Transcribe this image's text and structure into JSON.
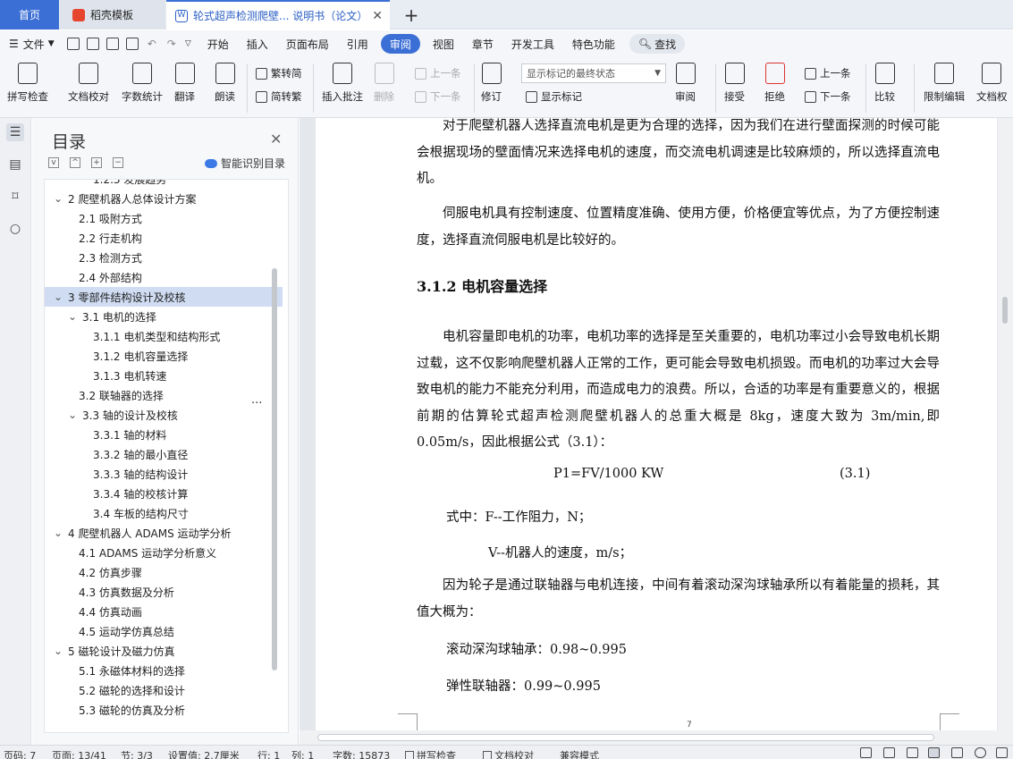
{
  "tabs": {
    "home": "首页",
    "template": "稻壳模板",
    "document": "轮式超声检测爬壁... 说明书（论文）",
    "add": "+",
    "close": "✕"
  },
  "menu": {
    "file": "文件",
    "items": [
      "开始",
      "插入",
      "页面布局",
      "引用",
      "审阅",
      "视图",
      "章节",
      "开发工具",
      "特色功能"
    ],
    "active": "审阅",
    "search": "查找"
  },
  "ribbon": {
    "spellcheck": "拼写检查",
    "doccheck": "文档校对",
    "wordcount": "字数统计",
    "translate": "翻译",
    "readaloud": "朗读",
    "trad": "繁转简",
    "simp": "简转繁",
    "addcomment": "插入批注",
    "delete": "删除",
    "prev_comment": "上一条",
    "next_comment": "下一条",
    "revise": "修订",
    "mark_state": "显示标记的最终状态",
    "show_marks": "显示标记",
    "review": "审阅",
    "accept": "接受",
    "reject": "拒绝",
    "prev_change": "上一条",
    "next_change": "下一条",
    "compare": "比较",
    "restrict": "限制编辑",
    "docauth": "文档权"
  },
  "toc": {
    "title": "目录",
    "smart": "智能识别目录",
    "items": [
      {
        "label": "1.2.3 发展趋势",
        "level": 3,
        "chev": ""
      },
      {
        "label": "2 爬壁机器人总体设计方案",
        "level": 1,
        "chev": "v"
      },
      {
        "label": "2.1 吸附方式",
        "level": 2,
        "chev": ""
      },
      {
        "label": "2.2 行走机构",
        "level": 2,
        "chev": ""
      },
      {
        "label": "2.3 检测方式",
        "level": 2,
        "chev": ""
      },
      {
        "label": "2.4 外部结构",
        "level": 2,
        "chev": ""
      },
      {
        "label": "3 零部件结构设计及校核",
        "level": 1,
        "chev": "v",
        "selected": true
      },
      {
        "label": "3.1 电机的选择",
        "level": 2,
        "chev": "v"
      },
      {
        "label": "3.1.1 电机类型和结构形式",
        "level": 3,
        "chev": ""
      },
      {
        "label": "3.1.2 电机容量选择",
        "level": 3,
        "chev": ""
      },
      {
        "label": "3.1.3 电机转速",
        "level": 3,
        "chev": ""
      },
      {
        "label": "3.2 联轴器的选择",
        "level": 2,
        "chev": ""
      },
      {
        "label": "3.3 轴的设计及校核",
        "level": 2,
        "chev": "v"
      },
      {
        "label": "3.3.1 轴的材料",
        "level": 3,
        "chev": ""
      },
      {
        "label": "3.3.2 轴的最小直径",
        "level": 3,
        "chev": ""
      },
      {
        "label": "3.3.3 轴的结构设计",
        "level": 3,
        "chev": ""
      },
      {
        "label": "3.3.4 轴的校核计算",
        "level": 3,
        "chev": ""
      },
      {
        "label": "3.4 车板的结构尺寸",
        "level": 3,
        "chev": ""
      },
      {
        "label": "4  爬壁机器人 ADAMS 运动学分析",
        "level": 1,
        "chev": "v"
      },
      {
        "label": "4.1 ADAMS 运动学分析意义",
        "level": 2,
        "chev": ""
      },
      {
        "label": "4.2 仿真步骤",
        "level": 2,
        "chev": ""
      },
      {
        "label": "4.3 仿真数据及分析",
        "level": 2,
        "chev": ""
      },
      {
        "label": "4.4 仿真动画",
        "level": 2,
        "chev": ""
      },
      {
        "label": "4.5 运动学仿真总结",
        "level": 2,
        "chev": ""
      },
      {
        "label": "5  磁轮设计及磁力仿真",
        "level": 1,
        "chev": "v"
      },
      {
        "label": "5.1 永磁体材料的选择",
        "level": 2,
        "chev": ""
      },
      {
        "label": "5.2 磁轮的选择和设计",
        "level": 2,
        "chev": ""
      },
      {
        "label": "5.3 磁轮的仿真及分析",
        "level": 2,
        "chev": ""
      }
    ],
    "ellipsis": "..."
  },
  "doc": {
    "p1": "对于爬壁机器人选择直流电机是更为合理的选择，因为我们在进行壁面探测的时候可能会根据现场的壁面情况来选择电机的速度，而交流电机调速是比较麻烦的，所以选择直流电机。",
    "p2": "伺服电机具有控制速度、位置精度准确、使用方便，价格便宜等优点，为了方便控制速度，选择直流伺服电机是比较好的。",
    "heading": "3.1.2 电机容量选择",
    "p3": "电机容量即电机的功率，电机功率的选择是至关重要的，电机功率过小会导致电机长期过载，这不仅影响爬壁机器人正常的工作，更可能会导致电机损毁。而电机的功率过大会导致电机的能力不能充分利用，而造成电力的浪费。所以，合适的功率是有重要意义的，根据前期的估算轮式超声检测爬壁机器人的总重大概是 8kg，速度大致为 3m/min,即 0.05m/s，因此根据公式（3.1）：",
    "formula": "P1=FV/1000 KW",
    "formula_no": "(3.1)",
    "where1": "式中：F--工作阻力，N；",
    "where2": "V--机器人的速度，m/s；",
    "p4": "因为轮子是通过联轴器与电机连接，中间有着滚动深沟球轴承所以有着能量的损耗，其值大概为：",
    "e1": "滚动深沟球轴承：0.98~0.995",
    "e2": "弹性联轴器：0.99~0.995",
    "page_number": "7"
  },
  "status": {
    "section": "页码: 7",
    "page": "页面: 13/41",
    "sec": "节: 3/3",
    "setting": "设置值: 2.7厘米",
    "row": "行: 1",
    "col": "列: 1",
    "words": "字数: 15873",
    "spell": "拼写检查",
    "proof": "文档校对",
    "compat": "兼容模式"
  }
}
